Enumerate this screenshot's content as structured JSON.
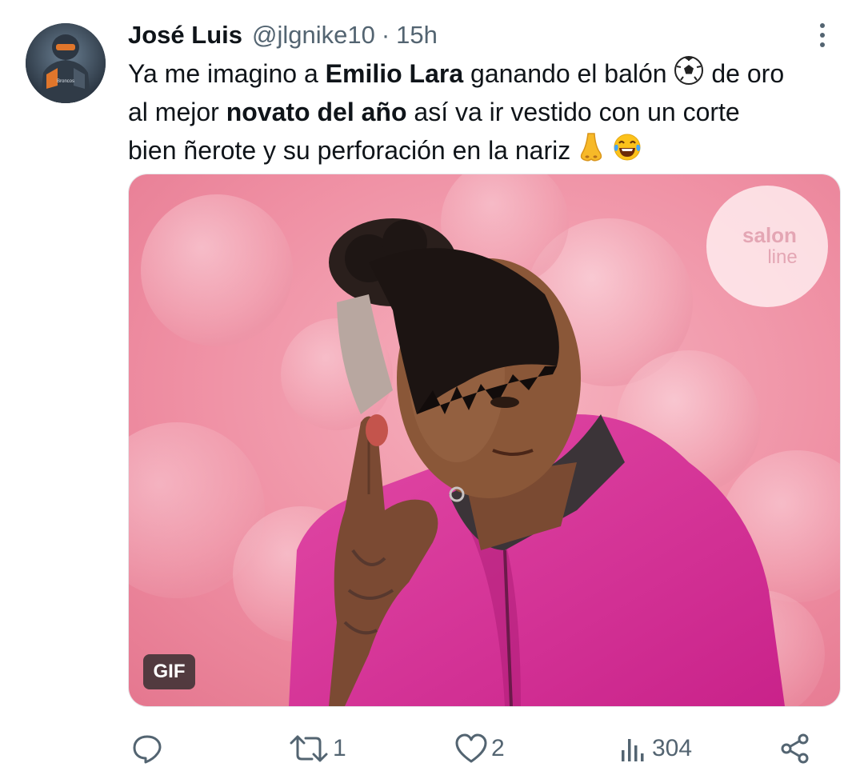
{
  "tweet": {
    "author_name": "José Luis",
    "handle": "@jlgnike10",
    "separator": "·",
    "time": "15h",
    "avatar_text": "Broncos",
    "text": {
      "line1_a": "Ya me imagino a ",
      "line1_b": "Emilio Lara",
      "line1_c": " ganando el balón ",
      "line1_d": " de oro",
      "line2_a": "al mejor ",
      "line2_b": "novato del año",
      "line2_c": " así va ir vestido con un corte",
      "line3_a": "bien ñerote y su perforación en la nariz "
    },
    "emojis": [
      "soccer-ball-icon",
      "nose-icon",
      "tears-of-joy-icon"
    ]
  },
  "media": {
    "badge": "GIF",
    "watermark_line1": "salon",
    "watermark_line2": "line"
  },
  "actions": {
    "reply_count": "",
    "retweet_count": "1",
    "like_count": "2",
    "views_count": "304"
  },
  "colors": {
    "text": "#0f1419",
    "secondary": "#536471",
    "media_background": "#f08fa2",
    "jacket": "#d8339a"
  }
}
